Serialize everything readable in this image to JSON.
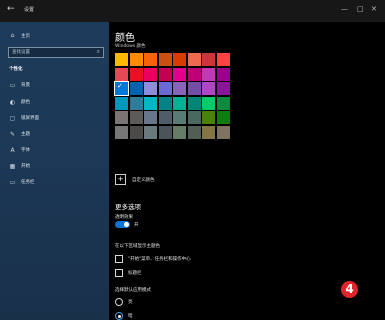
{
  "titlebar": {
    "title": "设置",
    "back_icon": "back-arrow-icon",
    "min_glyph": "—",
    "max_glyph": "□",
    "close_glyph": "✕"
  },
  "sidebar": {
    "home_label": "主页",
    "search_placeholder": "查找设置",
    "section_label": "个性化",
    "items": [
      {
        "label": "背景",
        "icon": "image-icon",
        "glyph": "▭"
      },
      {
        "label": "颜色",
        "icon": "palette-icon",
        "glyph": "◐"
      },
      {
        "label": "锁屏界面",
        "icon": "lock-screen-icon",
        "glyph": "▢"
      },
      {
        "label": "主题",
        "icon": "theme-icon",
        "glyph": "✎"
      },
      {
        "label": "字体",
        "icon": "font-icon",
        "glyph": "A"
      },
      {
        "label": "开始",
        "icon": "start-icon",
        "glyph": "▦"
      },
      {
        "label": "任务栏",
        "icon": "taskbar-icon",
        "glyph": "▭"
      }
    ]
  },
  "main": {
    "page_title": "颜色",
    "palette_label": "Windows 颜色",
    "palette": [
      [
        "#ffb900",
        "#ff8c00",
        "#f7630c",
        "#ca5010",
        "#da3b01",
        "#ef6950",
        "#d13438",
        "#ff4343"
      ],
      [
        "#e74856",
        "#e81123",
        "#ea005e",
        "#c30052",
        "#e3008c",
        "#bf0077",
        "#c239b3",
        "#9a0089"
      ],
      [
        "#0078d7",
        "#0063b1",
        "#8e8cd8",
        "#6b69d6",
        "#8764b8",
        "#744da9",
        "#b146c2",
        "#881798"
      ],
      [
        "#0099bc",
        "#2d7d9a",
        "#00b7c3",
        "#038387",
        "#00b294",
        "#018574",
        "#00cc6a",
        "#10893e"
      ],
      [
        "#7a7574",
        "#5d5a58",
        "#68768a",
        "#515c6b",
        "#567c73",
        "#486860",
        "#498205",
        "#107c10"
      ],
      [
        "#767676",
        "#4c4a48",
        "#69797e",
        "#4a5459",
        "#647c64",
        "#525e54",
        "#847545",
        "#7e735f"
      ]
    ],
    "selected_color": "#0078d7",
    "custom_color_label": "自定义颜色",
    "more_options_title": "更多选项",
    "transparency_label": "透明效果",
    "transparency_state": "开",
    "show_accent_label": "在以下区域显示主题色",
    "show_accent_options": [
      "\"开始\"菜单、任务栏和操作中心",
      "标题栏"
    ],
    "app_mode_label": "选择默认应用模式",
    "app_modes": [
      "亮",
      "暗"
    ],
    "selected_mode": "暗"
  },
  "badge": "4",
  "colors": {
    "sidebar_bg": "#1c3856",
    "accent": "#0f74d6",
    "badge": "#e1242b"
  }
}
